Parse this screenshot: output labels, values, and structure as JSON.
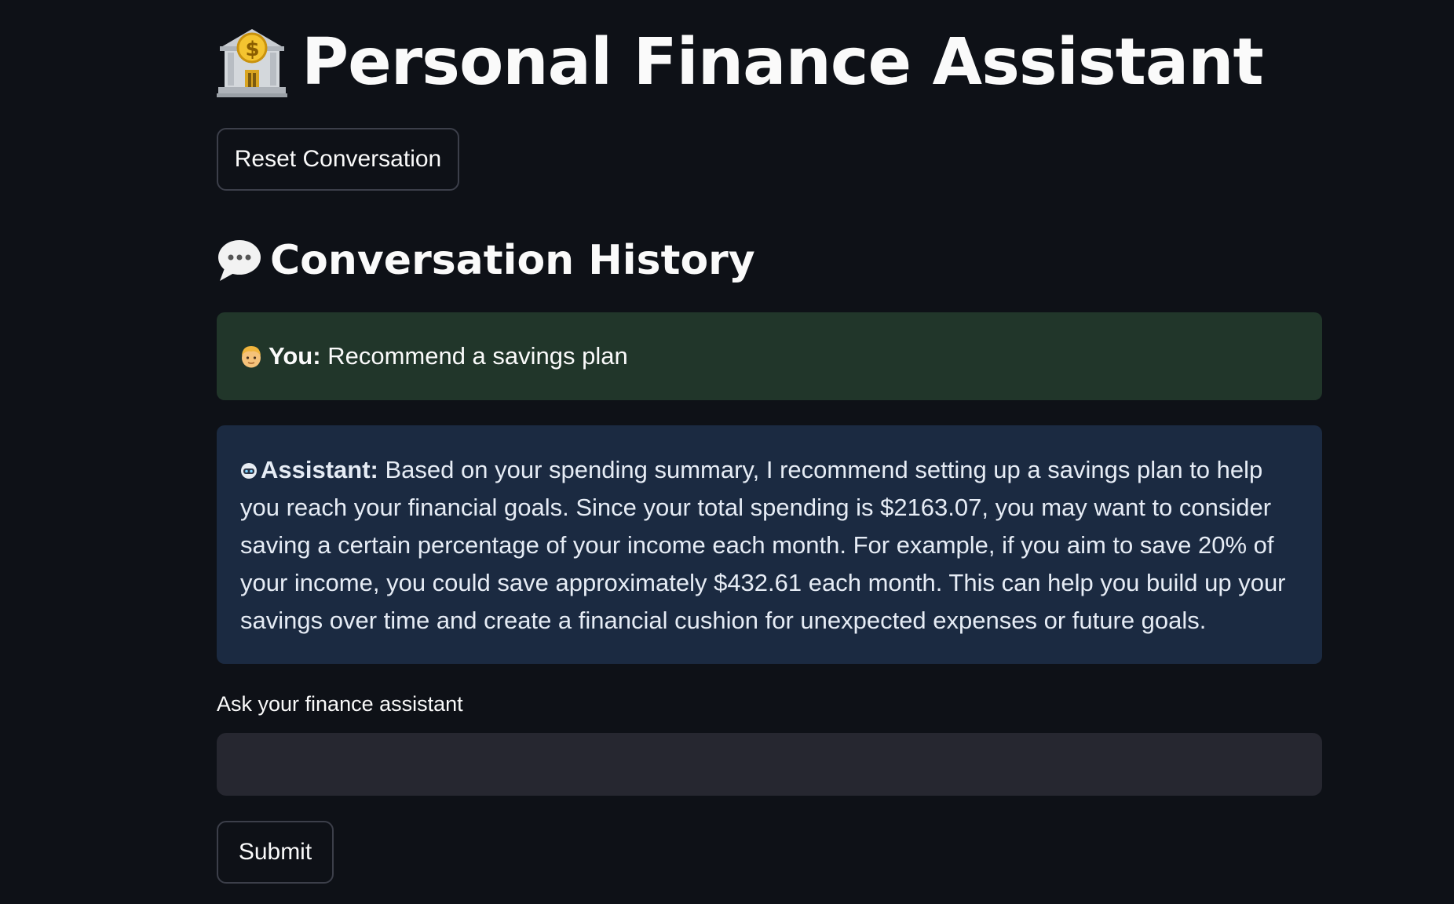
{
  "header": {
    "title": "Personal Finance Assistant",
    "title_icon": "bank-icon"
  },
  "reset_button": {
    "label": "Reset Conversation"
  },
  "history": {
    "heading": "Conversation History",
    "heading_icon": "speech-bubble-icon",
    "messages": [
      {
        "role": "user",
        "icon": "person-icon",
        "speaker": "You:",
        "text": "Recommend a savings plan",
        "bg_color": "#21362a"
      },
      {
        "role": "assistant",
        "icon": "robot-icon",
        "speaker": "Assistant:",
        "text": "Based on your spending summary, I recommend setting up a savings plan to help you reach your financial goals. Since your total spending is $2163.07, you may want to consider saving a certain percentage of your income each month. For example, if you aim to save 20% of your income, you could save approximately $432.61 each month. This can help you build up your savings over time and create a financial cushion for unexpected expenses or future goals.",
        "bg_color": "#1b2a41"
      }
    ]
  },
  "input": {
    "label": "Ask your finance assistant",
    "value": "",
    "placeholder": ""
  },
  "submit_button": {
    "label": "Submit"
  },
  "colors": {
    "background": "#0e1117",
    "input_background": "#262730",
    "button_border": "#3c3f4a"
  }
}
